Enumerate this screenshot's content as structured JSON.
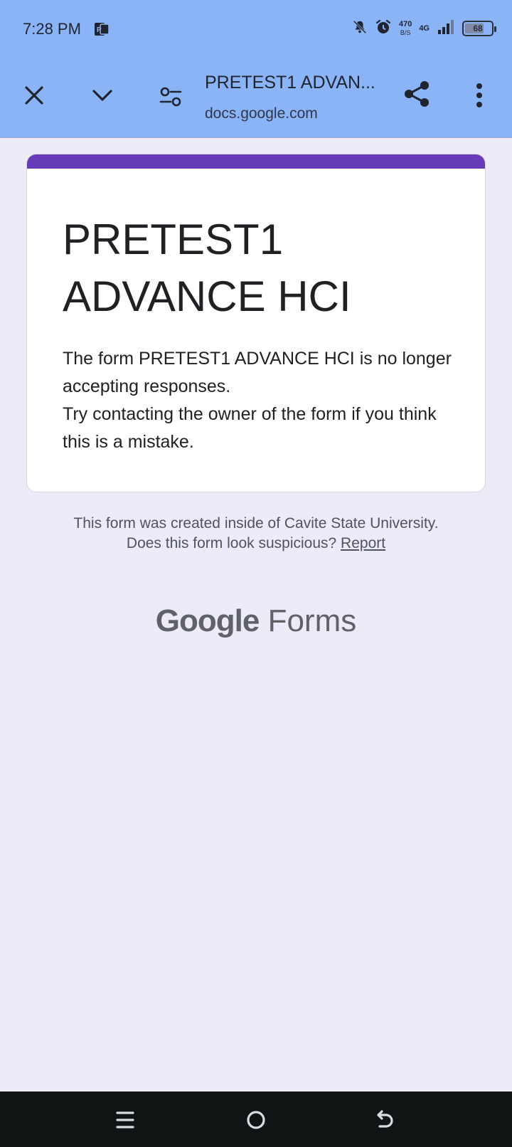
{
  "status_bar": {
    "time": "7:28 PM",
    "network_speed": "470",
    "network_speed_unit": "B/S",
    "network_type": "4G",
    "battery_level": "68",
    "icons": [
      "app-notification-icon",
      "bell-off-icon",
      "alarm-icon",
      "signal-icon",
      "battery-icon"
    ]
  },
  "toolbar": {
    "title": "PRETEST1 ADVAN...",
    "url": "docs.google.com",
    "icons": [
      "close-icon",
      "chevron-down-icon",
      "site-settings-icon",
      "share-icon",
      "more-vert-icon"
    ]
  },
  "card": {
    "accent_color": "#673ab7",
    "title": "PRETEST1 ADVANCE HCI",
    "message_line1": "The form PRETEST1 ADVANCE HCI is no longer accepting responses.",
    "message_line2": "Try contacting the owner of the form if you think this is a mistake."
  },
  "footer": {
    "created_inside": "This form was created inside of Cavite State University.",
    "suspicious_prompt": "Does this form look suspicious?",
    "report_link": "Report"
  },
  "brand": {
    "google": "Google",
    "forms": "Forms"
  },
  "nav_bar": {
    "icons": [
      "recent-apps-icon",
      "home-icon",
      "back-icon"
    ]
  }
}
